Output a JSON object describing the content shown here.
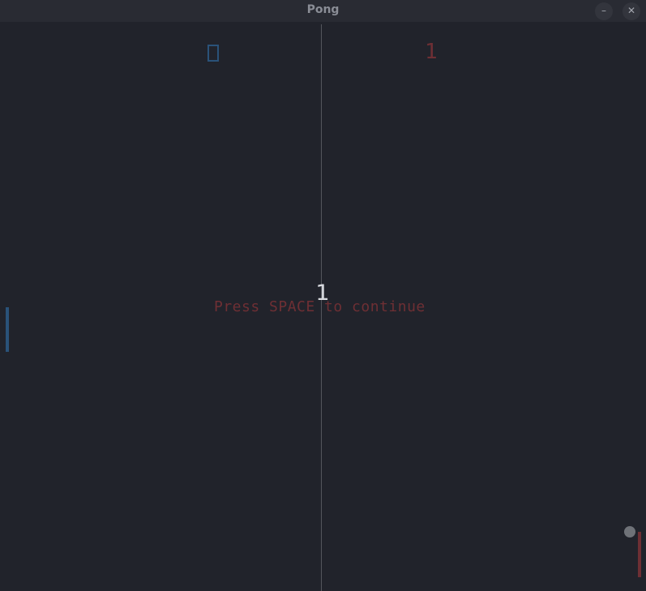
{
  "window": {
    "title": "Pong",
    "minimize_label": "–",
    "close_label": "✕"
  },
  "game": {
    "score_left": "0",
    "score_right": "1",
    "countdown": "1",
    "prompt": "Press SPACE to continue",
    "colors": {
      "background": "#21232b",
      "left_player": "#2a5279",
      "right_player": "#6e2f34",
      "center_line": "#54565d",
      "ball": "#6f7278",
      "countdown": "#d8dadf"
    }
  }
}
